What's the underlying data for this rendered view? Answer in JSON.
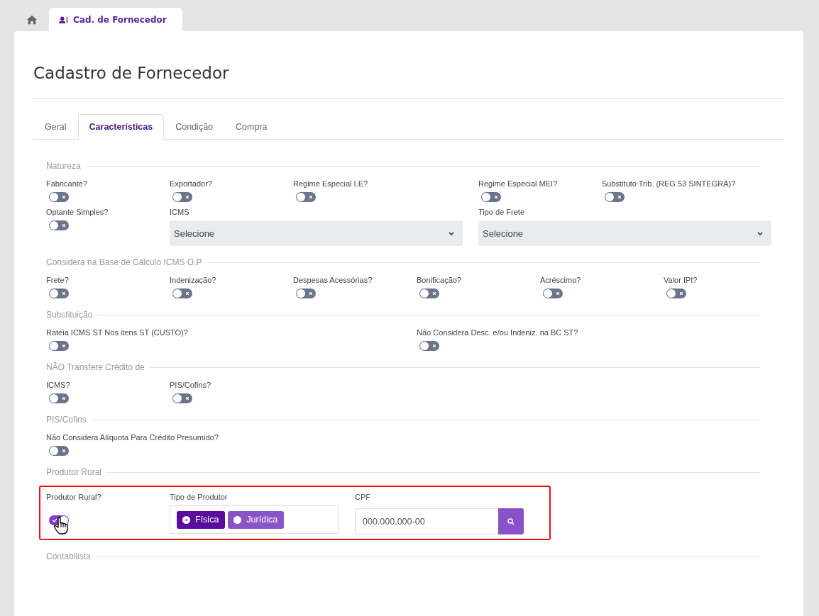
{
  "top_tabs": [
    {
      "kind": "home",
      "selected": false
    },
    {
      "kind": "page",
      "label": "Cad. de Fornecedor",
      "selected": true
    }
  ],
  "title": "Cadastro de Fornecedor",
  "tabs": [
    {
      "label": "Geral",
      "selected": false
    },
    {
      "label": "Características",
      "selected": true
    },
    {
      "label": "Condição",
      "selected": false
    },
    {
      "label": "Compra",
      "selected": false
    }
  ],
  "sections": [
    {
      "legend": "Natureza",
      "fields": [
        {
          "kind": "toggle",
          "label": "Fabricante?",
          "on": false
        },
        {
          "kind": "toggle",
          "label": "Exportador?",
          "on": false
        },
        {
          "kind": "toggle",
          "label": "Regime Especial I.E?",
          "on": false
        },
        {
          "kind": "toggle",
          "label": "Regime Especial MEI?",
          "on": false
        },
        {
          "kind": "toggle",
          "label": "Substituto Trib. (REG 53 SINTEGRA)?",
          "on": false
        },
        {
          "kind": "toggle",
          "label": "Optante Simples?",
          "on": false
        },
        {
          "kind": "select",
          "label": "ICMS",
          "value": "Selecione"
        },
        {
          "kind": "select",
          "label": "Tipo de Frete",
          "value": "Selecione"
        }
      ]
    },
    {
      "legend": "Considera na Base de Cálculo ICMS O.P",
      "fields": [
        {
          "kind": "toggle",
          "label": "Frete?",
          "on": false
        },
        {
          "kind": "toggle",
          "label": "Indenização?",
          "on": false
        },
        {
          "kind": "toggle",
          "label": "Despesas Acessórias?",
          "on": false
        },
        {
          "kind": "toggle",
          "label": "Bonificação?",
          "on": false
        },
        {
          "kind": "toggle",
          "label": "Acréscimo?",
          "on": false
        },
        {
          "kind": "toggle",
          "label": "Valor IPI?",
          "on": false
        }
      ]
    },
    {
      "legend": "Substituição",
      "fields": [
        {
          "kind": "toggle",
          "label": "Rateia ICMS ST Nos itens ST (CUSTO)?",
          "on": false
        },
        {
          "kind": "toggle",
          "label": "Não Considera Desc. e/ou Indeniz. na BC ST?",
          "on": false
        }
      ]
    },
    {
      "legend": "NÃO Transfere Crédito de",
      "fields": [
        {
          "kind": "toggle",
          "label": "ICMS?",
          "on": false
        },
        {
          "kind": "toggle",
          "label": "PIS/Cofins?",
          "on": false
        }
      ]
    },
    {
      "legend": "PIS/Cofins",
      "fields": [
        {
          "kind": "toggle",
          "label": "Não Considera Alíquota Para Crédito Presumido?",
          "on": false
        }
      ]
    },
    {
      "legend": "Produtor Rural",
      "highlighted": true,
      "fields": [
        {
          "kind": "toggle",
          "label": "Produtor Rural?",
          "on": true
        },
        {
          "kind": "radios",
          "label": "Tipo de Produtor",
          "options": [
            {
              "label": "Física",
              "selected": true
            },
            {
              "label": "Jurídica",
              "selected": false
            }
          ]
        },
        {
          "kind": "search",
          "label": "CPF",
          "placeholder": "000.000.000-00"
        }
      ]
    },
    {
      "legend": "Contabilista"
    }
  ]
}
